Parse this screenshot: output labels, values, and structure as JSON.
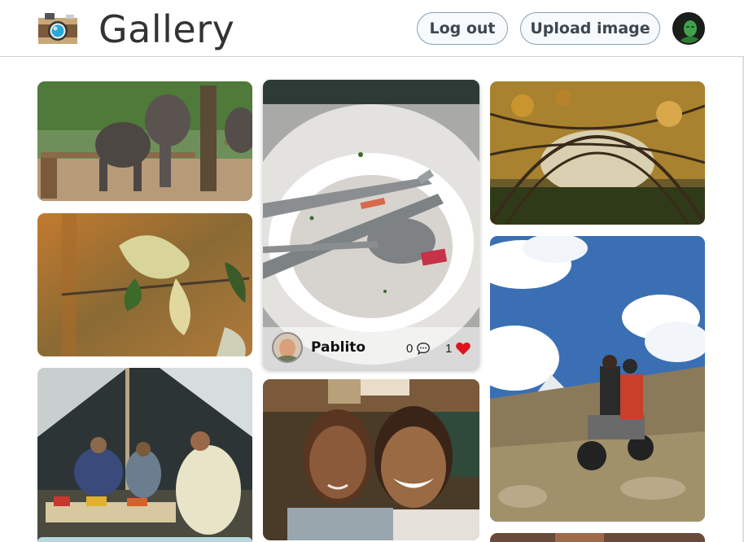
{
  "header": {
    "title": "Gallery",
    "logout_label": "Log out",
    "upload_label": "Upload image",
    "logo_icon": "camera-icon",
    "avatar_icon": "user-avatar"
  },
  "gallery": {
    "images": [
      {
        "name": "elephants-photo"
      },
      {
        "name": "plate-photo",
        "author": "Pablito",
        "comments": "0",
        "likes": "1"
      },
      {
        "name": "branch-dome-photo"
      },
      {
        "name": "leaf-photo"
      },
      {
        "name": "motorcycle-mountain-photo"
      },
      {
        "name": "tent-market-photo"
      },
      {
        "name": "smiling-girls-photo"
      }
    ]
  },
  "colors": {
    "like_heart": "#e0141e",
    "button_border": "#8aa0b0",
    "header_border": "#cfd3d6"
  }
}
